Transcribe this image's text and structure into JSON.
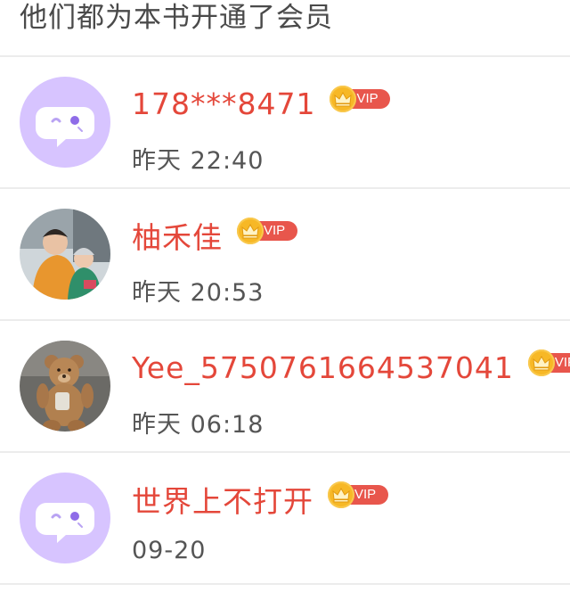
{
  "header": {
    "title": "他们都为本书开通了会员"
  },
  "members": [
    {
      "name": "178***8471",
      "badge": "VIP",
      "time": "昨天 22:40",
      "avatar": "default-chat-avatar"
    },
    {
      "name": "柚禾佳",
      "badge": "VIP",
      "time": "昨天 20:53",
      "avatar": "photo-children"
    },
    {
      "name": "Yee_5750761664537041",
      "badge": "VIP",
      "time": "昨天 06:18",
      "avatar": "photo-teddy-bear"
    },
    {
      "name": "世界上不打开",
      "badge": "VIP",
      "time": "09-20",
      "avatar": "default-chat-avatar"
    }
  ],
  "colors": {
    "name": "#e4473a",
    "vip_pill": "#e8564c",
    "crown": "#f7b826",
    "default_avatar_bg": "#d7c4ff"
  }
}
